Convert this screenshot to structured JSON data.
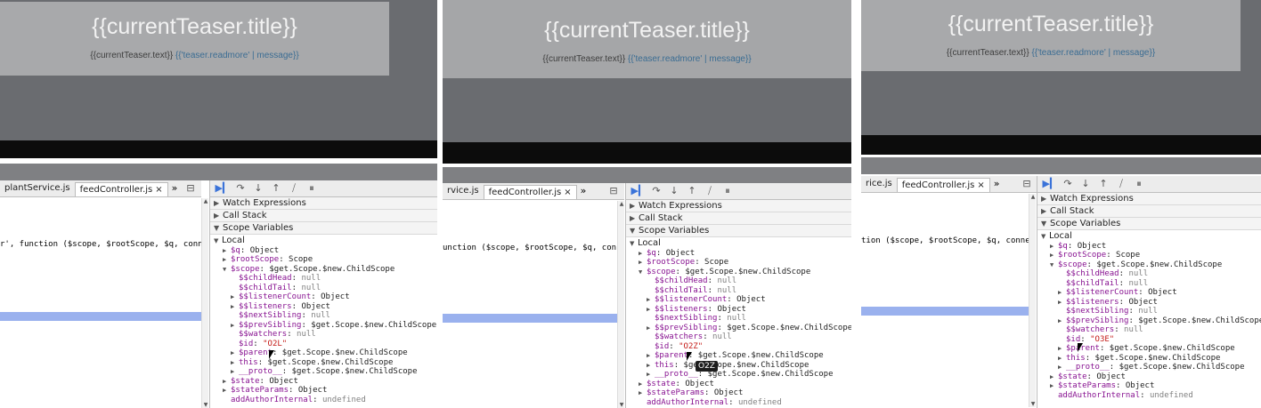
{
  "teaser": {
    "title": "{{currentTeaser.title}}",
    "text": "{{currentTeaser.text}}",
    "readmore": "{{'teaser.readmore' | message}}"
  },
  "panes": [
    {
      "tabs": [
        "plantService.js",
        "feedController.js"
      ],
      "more": "»",
      "code_line": "r', function ($scope, $rootScope, $q, conne",
      "id_value": "\"O2L\""
    },
    {
      "tabs": [
        "rvice.js",
        "feedController.js"
      ],
      "more": "»",
      "code_line": "unction ($scope, $rootScope, $q, conne",
      "id_value": "\"O2Z\"",
      "tooltip": "O2Z"
    },
    {
      "tabs": [
        "rice.js",
        "feedController.js"
      ],
      "more": "»",
      "code_line": "tion ($scope, $rootScope, $q, conne",
      "id_value": "\"O3E\""
    }
  ],
  "sidebar": {
    "sections": [
      "Watch Expressions",
      "Call Stack",
      "Scope Variables"
    ],
    "local_label": "Local",
    "vars": [
      {
        "key": "$q",
        "val": "Object",
        "tri": "▶",
        "indent": 1
      },
      {
        "key": "$rootScope",
        "val": "Scope",
        "tri": "▶",
        "indent": 1
      },
      {
        "key": "$scope",
        "val": "$get.Scope.$new.ChildScope",
        "tri": "▼",
        "indent": 1
      },
      {
        "key": "$$childHead",
        "val": "null",
        "tri": "",
        "indent": 2
      },
      {
        "key": "$$childTail",
        "val": "null",
        "tri": "",
        "indent": 2
      },
      {
        "key": "$$listenerCount",
        "val": "Object",
        "tri": "▶",
        "indent": 2
      },
      {
        "key": "$$listeners",
        "val": "Object",
        "tri": "▶",
        "indent": 2
      },
      {
        "key": "$$nextSibling",
        "val": "null",
        "tri": "",
        "indent": 2
      },
      {
        "key": "$$prevSibling",
        "val": "$get.Scope.$new.ChildScope",
        "tri": "▶",
        "indent": 2
      },
      {
        "key": "$$watchers",
        "val": "null",
        "tri": "",
        "indent": 2
      },
      {
        "key": "$id",
        "val": "",
        "tri": "",
        "indent": 2,
        "is_id": true
      },
      {
        "key": "$parent",
        "val": "$get.Scope.$new.ChildScope",
        "tri": "▶",
        "indent": 2
      },
      {
        "key": "this",
        "val": "$get.Scope.$new.ChildScope",
        "tri": "▶",
        "indent": 2
      },
      {
        "key": "__proto__",
        "val": "$get.Scope.$new.ChildScope",
        "tri": "▶",
        "indent": 2
      },
      {
        "key": "$state",
        "val": "Object",
        "tri": "▶",
        "indent": 1
      },
      {
        "key": "$stateParams",
        "val": "Object",
        "tri": "▶",
        "indent": 1
      },
      {
        "key": "addAuthorInternal",
        "val": "undefined",
        "tri": "",
        "indent": 1
      }
    ]
  },
  "icons": {
    "resume": "resume-icon",
    "step_over": "step-over-icon",
    "step_into": "step-into-icon",
    "step_out": "step-out-icon",
    "deactivate": "deactivate-breakpoints-icon",
    "pause": "pause-exceptions-icon"
  },
  "colors": {
    "preview_bg": "#6a6c70",
    "teaser_bg": "#a8a9ab",
    "highlight": "#9ab1ee",
    "key": "#881391",
    "string": "#c41a16"
  }
}
